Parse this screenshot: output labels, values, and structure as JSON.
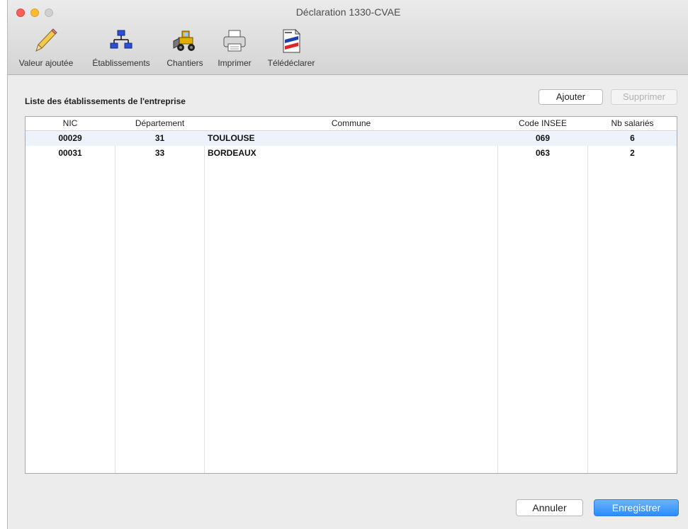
{
  "window": {
    "title": "Déclaration 1330-CVAE"
  },
  "toolbar": {
    "items": [
      {
        "label": "Valeur ajoutée",
        "icon": "pencil-icon"
      },
      {
        "label": "Établissements",
        "icon": "org-chart-icon"
      },
      {
        "label": "Chantiers",
        "icon": "excavator-icon"
      },
      {
        "label": "Imprimer",
        "icon": "printer-icon"
      },
      {
        "label": "Télédéclarer",
        "icon": "tax-form-icon"
      }
    ]
  },
  "main": {
    "section_title": "Liste des établissements de l'entreprise",
    "add_label": "Ajouter",
    "delete_label": "Supprimer",
    "table": {
      "columns": [
        "NIC",
        "Département",
        "Commune",
        "Code INSEE",
        "Nb salariés"
      ],
      "rows": [
        [
          "00029",
          "31",
          "TOULOUSE",
          "069",
          "6"
        ],
        [
          "00031",
          "33",
          "BORDEAUX",
          "063",
          "2"
        ]
      ]
    }
  },
  "footer": {
    "cancel_label": "Annuler",
    "save_label": "Enregistrer"
  }
}
